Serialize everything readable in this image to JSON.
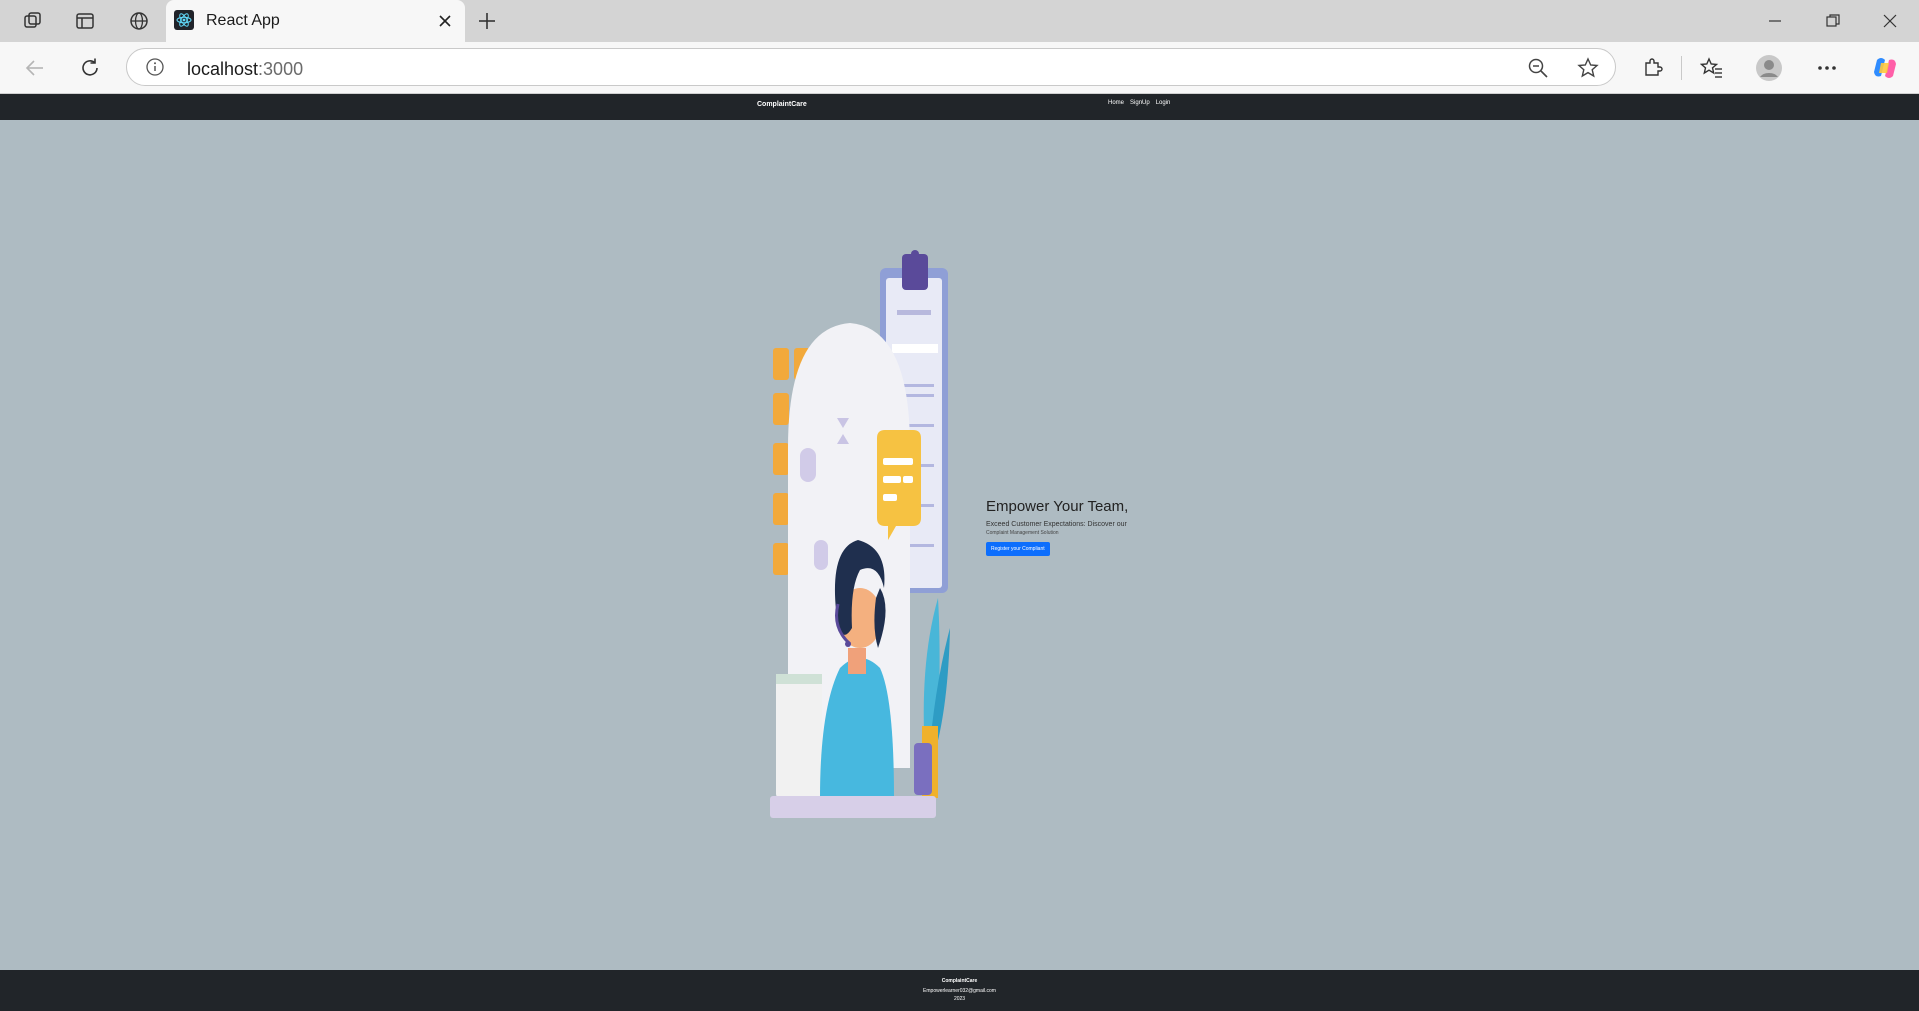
{
  "browser": {
    "tab_title": "React App",
    "address_host": "localhost",
    "address_port": ":3000",
    "icons": [
      "workspaces-icon",
      "tab-actions-icon",
      "globe-icon",
      "react-favicon",
      "close-icon",
      "new-tab-icon",
      "minimize-icon",
      "restore-icon",
      "window-close-icon",
      "back-icon",
      "refresh-icon",
      "site-info-icon",
      "zoom-out-icon",
      "favorite-star-icon",
      "extensions-icon",
      "favorites-icon",
      "profile-icon",
      "more-icon",
      "copilot-icon"
    ]
  },
  "navbar": {
    "brand": "ComplaintCare",
    "links": [
      "Home",
      "SignUp",
      "Login"
    ]
  },
  "hero": {
    "title": "Empower Your Team,",
    "subtitle": "Exceed Customer Expectations: Discover our",
    "subtitle2": "Complaint Management Solution",
    "button": "Register your Compliant"
  },
  "footer": {
    "brand": "ComplaintCare",
    "email": "Empowerlearner032@gmail.com",
    "year": "2023"
  },
  "colors": {
    "page_bg": "#aebbc2",
    "navbar_bg": "#212529",
    "button_bg": "#0d6efd"
  }
}
